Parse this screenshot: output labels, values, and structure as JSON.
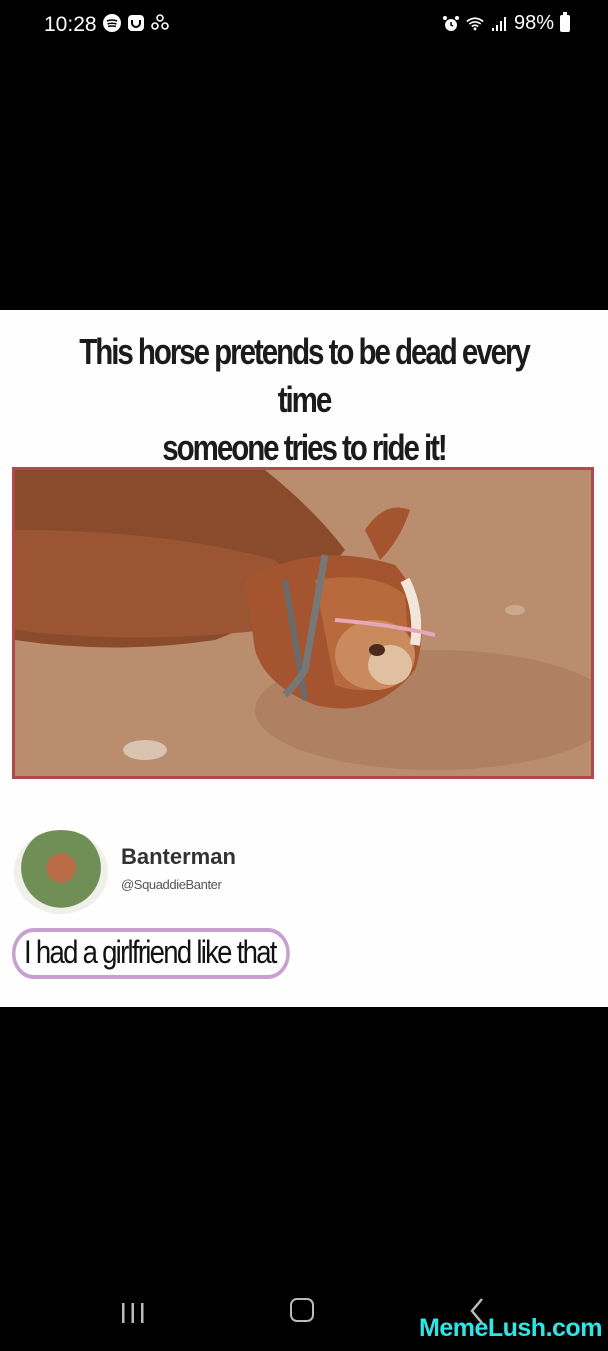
{
  "status_bar": {
    "time": "10:28",
    "left_icons": [
      "spotify-icon",
      "notification-app-icon",
      "pinwheel-icon"
    ],
    "right_icons": [
      "alarm-icon",
      "wifi-icon",
      "signal-icon"
    ],
    "battery": "98%"
  },
  "meme": {
    "caption_line1": "This horse pretends to be dead every time",
    "caption_line2": "someone tries to ride it!",
    "tweet": {
      "name": "Banterman",
      "handle": "@SquaddieBanter",
      "text": "I had a girlfriend like that"
    }
  },
  "nav": {
    "recents_icon": "recents-icon",
    "home_icon": "home-icon",
    "back_icon": "back-icon"
  },
  "watermark": "MemeLush.com"
}
